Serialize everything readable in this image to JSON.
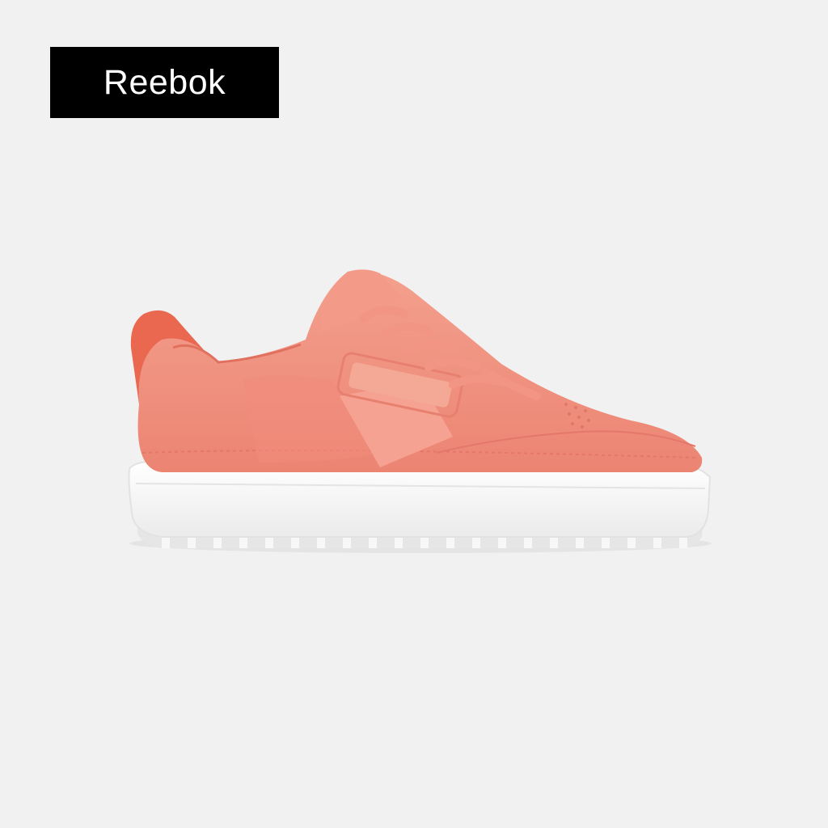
{
  "brand": {
    "label": "Reebok"
  },
  "product": {
    "icon": "sneaker-icon",
    "colors": {
      "background": "#f1f1f1",
      "badge": "#000000",
      "upper": "#f08c7c",
      "heel_tab": "#e9684f",
      "sole": "#ffffff"
    }
  }
}
